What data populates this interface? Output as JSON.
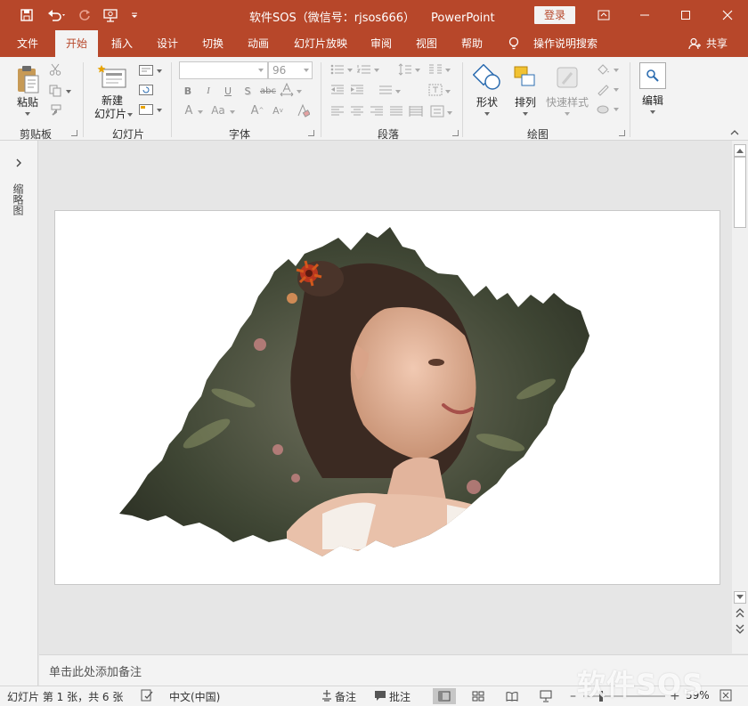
{
  "window": {
    "title": "软件SOS（微信号：rjsos666）",
    "app": "PowerPoint",
    "login": "登录"
  },
  "tabs": [
    {
      "label": "文件"
    },
    {
      "label": "开始"
    },
    {
      "label": "插入"
    },
    {
      "label": "设计"
    },
    {
      "label": "切换"
    },
    {
      "label": "动画"
    },
    {
      "label": "幻灯片放映"
    },
    {
      "label": "审阅"
    },
    {
      "label": "视图"
    },
    {
      "label": "帮助"
    },
    {
      "label": "操作说明搜索"
    }
  ],
  "share": "共享",
  "ribbon": {
    "clipboard": {
      "paste": "粘贴",
      "label": "剪贴板"
    },
    "slides": {
      "new_slide_1": "新建",
      "new_slide_2": "幻灯片",
      "label": "幻灯片"
    },
    "font": {
      "font_size": "96",
      "label": "字体",
      "bold": "B",
      "italic": "I",
      "underline": "U",
      "shadow": "S",
      "strike": "abc",
      "case": "Aa"
    },
    "paragraph": {
      "label": "段落"
    },
    "drawing": {
      "shape": "形状",
      "arrange": "排列",
      "quick_styles": "快速样式",
      "label": "绘图"
    },
    "editing": {
      "edit": "编辑"
    }
  },
  "left_pane": {
    "label": "缩略图"
  },
  "notes": {
    "placeholder": "单击此处添加备注"
  },
  "status": {
    "slide_info": "幻灯片 第 1 张，共 6 张",
    "language": "中文(中国)",
    "notes_btn": "备注",
    "comments_btn": "批注",
    "zoom": "59%"
  },
  "watermark": "软件SOS",
  "colors": {
    "accent": "#b7472a"
  }
}
